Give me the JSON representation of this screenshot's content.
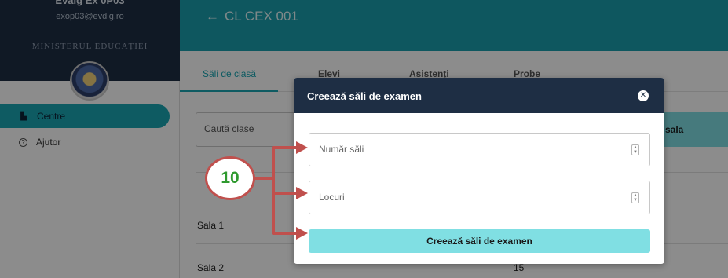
{
  "sidebar": {
    "user_name": "Evalg Ex 0P03",
    "user_email": "exop03@evdig.ro",
    "ministry": "MINISTERUL EDUCAȚIEI",
    "items": [
      {
        "label": "Centre",
        "icon": "building-icon"
      },
      {
        "label": "Ajutor",
        "icon": "help-circle-icon"
      }
    ]
  },
  "header": {
    "back_icon": "←",
    "title": "CL CEX 001"
  },
  "tabs": [
    {
      "label": "Săli de clasă"
    },
    {
      "label": "Elevi"
    },
    {
      "label": "Asistenți"
    },
    {
      "label": "Probe"
    }
  ],
  "main": {
    "search_placeholder": "Caută clase",
    "add_button_label": "sala",
    "rows": [
      {
        "name": "Sala 1",
        "seats": ""
      },
      {
        "name": "Sala 2",
        "seats": "15"
      }
    ]
  },
  "modal": {
    "title": "Creează săli de examen",
    "close_icon": "✕",
    "fields": [
      {
        "placeholder": "Număr săli"
      },
      {
        "placeholder": "Locuri"
      }
    ],
    "submit_label": "Creează săli de examen"
  },
  "annotation": {
    "step": "10"
  },
  "colors": {
    "navy": "#1e2e44",
    "teal": "#1ba6b3",
    "button_light": "#80dfe3",
    "annotation_red": "#c0504d",
    "step_green": "#2f9a2f"
  }
}
